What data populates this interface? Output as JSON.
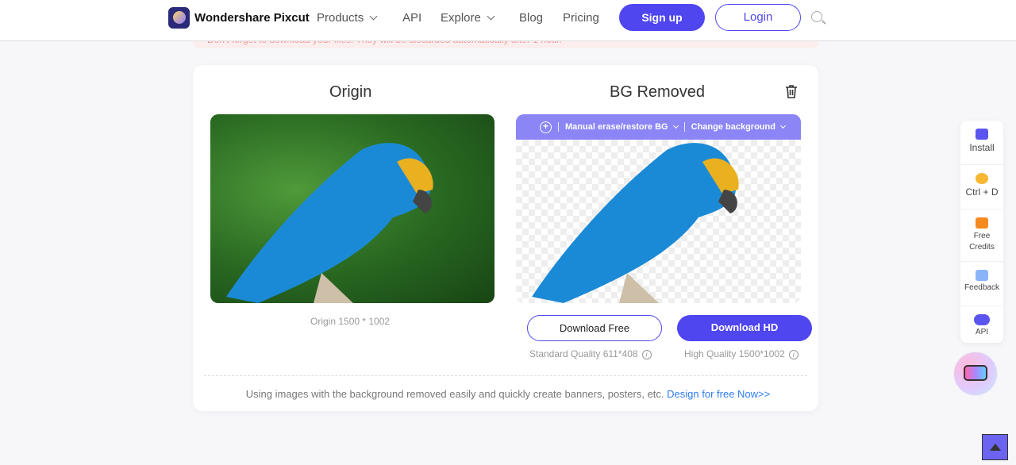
{
  "header": {
    "brand": "Wondershare Pixcut",
    "nav": [
      "Products",
      "API",
      "Explore",
      "Blog",
      "Pricing"
    ],
    "signup": "Sign up",
    "login": "Login"
  },
  "notice": "Don't forget to download your files. They will be discarded automatically after 1 hour.",
  "origin": {
    "title": "Origin",
    "caption": "Origin 1500 * 1002"
  },
  "removed": {
    "title": "BG Removed",
    "manual": "Manual erase/restore BG",
    "change_bg": "Change background"
  },
  "downloads": {
    "free_label": "Download Free",
    "hd_label": "Download HD",
    "free_quality": "Standard Quality 611*408",
    "hd_quality": "High Quality 1500*1002"
  },
  "footer": {
    "text": "Using images with the background removed easily and quickly create banners, posters, etc.",
    "link": "Design for free Now>>"
  },
  "sidebar": [
    {
      "label": "Install",
      "icon": "install-icon",
      "color": "#5b55f0"
    },
    {
      "label": "Ctrl + D",
      "icon": "star-icon",
      "color": "#f7b733"
    },
    {
      "label": "Free Credits",
      "icon": "gift-icon",
      "color": "#f58a1f"
    },
    {
      "label": "Feedback",
      "icon": "feedback-icon",
      "color": "#8ab4f8"
    },
    {
      "label": "API",
      "icon": "api-icon",
      "color": "#5b55f0"
    }
  ],
  "colors": {
    "accent": "#4f46f0",
    "link": "#2f7bf5"
  }
}
